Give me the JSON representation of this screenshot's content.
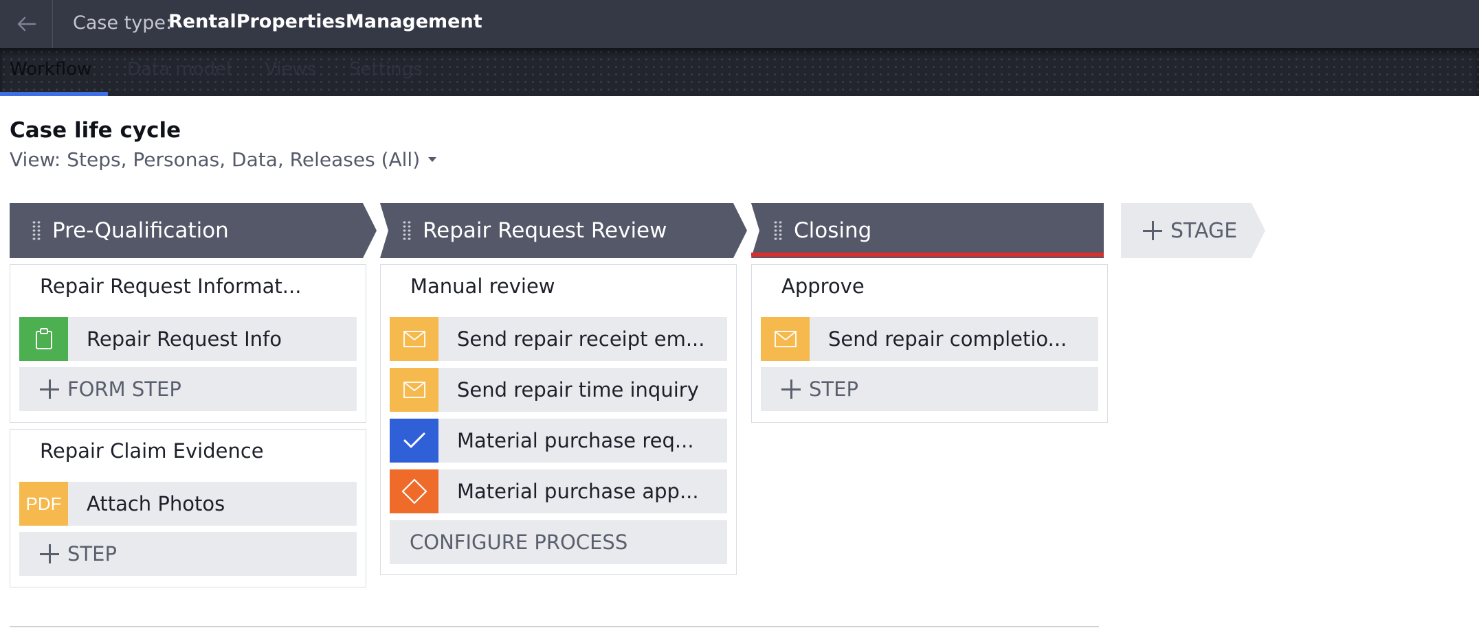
{
  "header": {
    "case_type_label": "Case type:",
    "case_type_name": "RentalPropertiesManagement"
  },
  "tabs": [
    {
      "label": "Workflow",
      "active": true
    },
    {
      "label": "Data model",
      "active": false
    },
    {
      "label": "Views",
      "active": false
    },
    {
      "label": "Settings",
      "active": false
    }
  ],
  "page": {
    "title": "Case life cycle",
    "view_filter": "View: Steps, Personas, Data, Releases (All)"
  },
  "stages": [
    {
      "name": "Pre-Qualification",
      "processes": [
        {
          "title": "Repair Request Informat...",
          "steps": [
            {
              "label": "Repair Request Info",
              "icon": "clipboard-icon",
              "icon_color": "#4caf50"
            }
          ],
          "add_label": "FORM STEP"
        },
        {
          "title": "Repair Claim Evidence",
          "steps": [
            {
              "label": "Attach Photos",
              "icon": "pdf-icon",
              "icon_text": "PDF",
              "icon_color": "#f5b94d"
            }
          ],
          "add_label": "STEP"
        }
      ]
    },
    {
      "name": "Repair Request Review",
      "processes": [
        {
          "title": "Manual review",
          "steps": [
            {
              "label": "Send repair receipt em...",
              "icon": "envelope-icon",
              "icon_color": "#f5b94d"
            },
            {
              "label": "Send repair time inquiry",
              "icon": "envelope-icon",
              "icon_color": "#f5b94d"
            },
            {
              "label": "Material purchase req...",
              "icon": "checkmark-icon",
              "icon_color": "#3060d8"
            },
            {
              "label": "Material purchase app...",
              "icon": "decision-diamond-icon",
              "icon_color": "#ee6b2a"
            }
          ],
          "configure_label": "CONFIGURE PROCESS"
        }
      ]
    },
    {
      "name": "Closing",
      "processes": [
        {
          "title": "Approve",
          "steps": [
            {
              "label": "Send repair completio...",
              "icon": "envelope-icon",
              "icon_color": "#f5b94d"
            }
          ],
          "add_label": "STEP"
        }
      ]
    }
  ],
  "add_stage_label": "STAGE",
  "colors": {
    "header_bg": "#353945",
    "stage_bg": "#545868",
    "tab_active_underline": "#3f6fe3",
    "closing_stage_accent": "#d9302c",
    "step_bg": "#e9eaee"
  }
}
